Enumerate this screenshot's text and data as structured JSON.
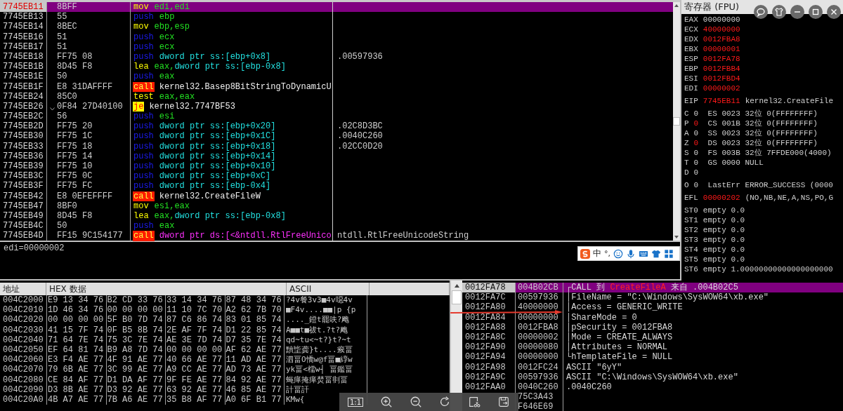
{
  "disassembly": {
    "rows": [
      {
        "address": "7745EB11",
        "bytes": "8BFF",
        "mnemonic": "mov",
        "kind": "move",
        "operands": [
          {
            "text": "edi,edi",
            "kind": "reg"
          }
        ],
        "selected": true,
        "jump_arrow": false
      },
      {
        "address": "7745EB13",
        "bytes": "55",
        "mnemonic": "push",
        "kind": "stack",
        "operands": [
          {
            "text": "ebp",
            "kind": "reg"
          }
        ],
        "selected": false,
        "jump_arrow": false
      },
      {
        "address": "7745EB14",
        "bytes": "8BEC",
        "mnemonic": "mov",
        "kind": "move",
        "operands": [
          {
            "text": "ebp,esp",
            "kind": "reg"
          }
        ],
        "selected": false,
        "jump_arrow": false
      },
      {
        "address": "7745EB16",
        "bytes": "51",
        "mnemonic": "push",
        "kind": "stack",
        "operands": [
          {
            "text": "ecx",
            "kind": "reg"
          }
        ],
        "selected": false,
        "jump_arrow": false
      },
      {
        "address": "7745EB17",
        "bytes": "51",
        "mnemonic": "push",
        "kind": "stack",
        "operands": [
          {
            "text": "ecx",
            "kind": "reg"
          }
        ],
        "selected": false,
        "jump_arrow": false
      },
      {
        "address": "7745EB18",
        "bytes": "FF75 08",
        "mnemonic": "push",
        "kind": "stack",
        "operands": [
          {
            "text": "dword ptr ss:[ebp+0x8]",
            "kind": "mem"
          }
        ],
        "comment": ".00597936",
        "selected": false,
        "jump_arrow": false
      },
      {
        "address": "7745EB1B",
        "bytes": "8D45 F8",
        "mnemonic": "lea",
        "kind": "move",
        "operands": [
          {
            "text": "eax,",
            "kind": "reg"
          },
          {
            "text": "dword ptr ss:[ebp-0x8]",
            "kind": "mem"
          }
        ],
        "selected": false,
        "jump_arrow": false
      },
      {
        "address": "7745EB1E",
        "bytes": "50",
        "mnemonic": "push",
        "kind": "stack",
        "operands": [
          {
            "text": "eax",
            "kind": "reg"
          }
        ],
        "selected": false,
        "jump_arrow": false
      },
      {
        "address": "7745EB1F",
        "bytes": "E8 31DAFFFF",
        "mnemonic": "call",
        "kind": "call",
        "operands": [
          {
            "text": "kernel32.Basep8BitStringToDynamicU",
            "kind": "target"
          }
        ],
        "selected": false,
        "jump_arrow": false
      },
      {
        "address": "7745EB24",
        "bytes": "85C0",
        "mnemonic": "test",
        "kind": "move",
        "operands": [
          {
            "text": "eax,eax",
            "kind": "reg"
          }
        ],
        "selected": false,
        "jump_arrow": false
      },
      {
        "address": "7745EB26",
        "bytes": "0F84 27D40100",
        "mnemonic": "je",
        "kind": "jump",
        "operands": [
          {
            "text": "kernel32.7747BF53",
            "kind": "target"
          }
        ],
        "selected": false,
        "jump_arrow": true
      },
      {
        "address": "7745EB2C",
        "bytes": "56",
        "mnemonic": "push",
        "kind": "stack",
        "operands": [
          {
            "text": "esi",
            "kind": "reg"
          }
        ],
        "selected": false,
        "jump_arrow": false
      },
      {
        "address": "7745EB2D",
        "bytes": "FF75 20",
        "mnemonic": "push",
        "kind": "stack",
        "operands": [
          {
            "text": "dword ptr ss:[ebp+0x20]",
            "kind": "mem"
          }
        ],
        "comment": ".02C8D3BC",
        "selected": false,
        "jump_arrow": false
      },
      {
        "address": "7745EB30",
        "bytes": "FF75 1C",
        "mnemonic": "push",
        "kind": "stack",
        "operands": [
          {
            "text": "dword ptr ss:[ebp+0x1C]",
            "kind": "mem"
          }
        ],
        "comment": ".0040C260",
        "selected": false,
        "jump_arrow": false
      },
      {
        "address": "7745EB33",
        "bytes": "FF75 18",
        "mnemonic": "push",
        "kind": "stack",
        "operands": [
          {
            "text": "dword ptr ss:[ebp+0x18]",
            "kind": "mem"
          }
        ],
        "comment": ".02CC0D20",
        "selected": false,
        "jump_arrow": false
      },
      {
        "address": "7745EB36",
        "bytes": "FF75 14",
        "mnemonic": "push",
        "kind": "stack",
        "operands": [
          {
            "text": "dword ptr ss:[ebp+0x14]",
            "kind": "mem"
          }
        ],
        "selected": false,
        "jump_arrow": false
      },
      {
        "address": "7745EB39",
        "bytes": "FF75 10",
        "mnemonic": "push",
        "kind": "stack",
        "operands": [
          {
            "text": "dword ptr ss:[ebp+0x10]",
            "kind": "mem"
          }
        ],
        "selected": false,
        "jump_arrow": false
      },
      {
        "address": "7745EB3C",
        "bytes": "FF75 0C",
        "mnemonic": "push",
        "kind": "stack",
        "operands": [
          {
            "text": "dword ptr ss:[ebp+0xC]",
            "kind": "mem"
          }
        ],
        "selected": false,
        "jump_arrow": false
      },
      {
        "address": "7745EB3F",
        "bytes": "FF75 FC",
        "mnemonic": "push",
        "kind": "stack",
        "operands": [
          {
            "text": "dword ptr ss:[ebp-0x4]",
            "kind": "mem"
          }
        ],
        "selected": false,
        "jump_arrow": false
      },
      {
        "address": "7745EB42",
        "bytes": "E8 0EFEFFFF",
        "mnemonic": "call",
        "kind": "call",
        "operands": [
          {
            "text": "kernel32.CreateFileW",
            "kind": "target"
          }
        ],
        "selected": false,
        "jump_arrow": false
      },
      {
        "address": "7745EB47",
        "bytes": "8BF0",
        "mnemonic": "mov",
        "kind": "move",
        "operands": [
          {
            "text": "esi,eax",
            "kind": "reg"
          }
        ],
        "selected": false,
        "jump_arrow": false
      },
      {
        "address": "7745EB49",
        "bytes": "8D45 F8",
        "mnemonic": "lea",
        "kind": "move",
        "operands": [
          {
            "text": "eax,",
            "kind": "reg"
          },
          {
            "text": "dword ptr ss:[ebp-0x8]",
            "kind": "mem"
          }
        ],
        "selected": false,
        "jump_arrow": false
      },
      {
        "address": "7745EB4C",
        "bytes": "50",
        "mnemonic": "push",
        "kind": "stack",
        "operands": [
          {
            "text": "eax",
            "kind": "reg"
          }
        ],
        "selected": false,
        "jump_arrow": false
      },
      {
        "address": "7745EB4D",
        "bytes": "FF15 9C154177",
        "mnemonic": "call",
        "kind": "call",
        "operands": [
          {
            "text": "dword ptr ds:[<&ntdll.RtlFreeUnico",
            "kind": "import"
          }
        ],
        "comment": "ntdll.RtlFreeUnicodeString",
        "selected": false,
        "jump_arrow": false
      }
    ]
  },
  "info": {
    "text": "edi=00000002"
  },
  "registers": {
    "title": "寄存器 (FPU)",
    "general": [
      {
        "name": "EAX",
        "value": "00000000",
        "changed": false
      },
      {
        "name": "ECX",
        "value": "40000000",
        "changed": true
      },
      {
        "name": "EDX",
        "value": "0012FBA8",
        "changed": true
      },
      {
        "name": "EBX",
        "value": "00000001",
        "changed": true
      },
      {
        "name": "ESP",
        "value": "0012FA78",
        "changed": true
      },
      {
        "name": "EBP",
        "value": "0012FBB4",
        "changed": true
      },
      {
        "name": "ESI",
        "value": "0012FBD4",
        "changed": true
      },
      {
        "name": "EDI",
        "value": "00000002",
        "changed": true
      }
    ],
    "eip": {
      "name": "EIP",
      "value": "7745EB11",
      "changed": true,
      "comment": "kernel32.CreateFile"
    },
    "flags": [
      {
        "flag": "C",
        "value": "0",
        "changed": false,
        "detail": "ES 0023 32位 0(FFFFFFFF)"
      },
      {
        "flag": "P",
        "value": "0",
        "changed": true,
        "detail": "CS 001B 32位 0(FFFFFFFF)"
      },
      {
        "flag": "A",
        "value": "0",
        "changed": false,
        "detail": "SS 0023 32位 0(FFFFFFFF)"
      },
      {
        "flag": "Z",
        "value": "0",
        "changed": true,
        "detail": "DS 0023 32位 0(FFFFFFFF)"
      },
      {
        "flag": "S",
        "value": "0",
        "changed": false,
        "detail": "FS 003B 32位 7FFDE000(4000)"
      },
      {
        "flag": "T",
        "value": "0",
        "changed": false,
        "detail": "GS 0000 NULL"
      },
      {
        "flag": "D",
        "value": "0",
        "changed": false
      },
      {
        "flag": "O",
        "value": "0",
        "changed": false,
        "detail": "LastErr ERROR_SUCCESS (0000"
      }
    ],
    "efl": {
      "name": "EFL",
      "value": "00000202",
      "changed": true,
      "comment": "(NO,NB,NE,A,NS,PO,G"
    },
    "fpu": [
      {
        "name": "ST0",
        "text": "empty 0.0"
      },
      {
        "name": "ST1",
        "text": "empty 0.0"
      },
      {
        "name": "ST2",
        "text": "empty 0.0"
      },
      {
        "name": "ST3",
        "text": "empty 0.0"
      },
      {
        "name": "ST4",
        "text": "empty 0.0"
      },
      {
        "name": "ST5",
        "text": "empty 0.0"
      },
      {
        "name": "ST6",
        "text": "empty 1.00000000000000000000"
      }
    ]
  },
  "dump": {
    "columns": [
      "地址",
      "HEX 数据",
      "ASCII"
    ],
    "rows": [
      {
        "address": "004C2000",
        "hex": [
          "E9 13 34 76",
          "B2 CD 33 76",
          "33 14 34 76",
          "87 48 34 76"
        ],
        "ascii": "?4v餐3v3■4v噁4v"
      },
      {
        "address": "004C2010",
        "hex": [
          "1D 46 34 76",
          "00 00 00 00",
          "11 10 7C 70",
          "A2 62 7B 70"
        ],
        "ascii": "■F4v....■■|p  {p"
      },
      {
        "address": "004C2020",
        "hex": [
          "00 00 00 00",
          "5F B0 7D 74",
          "87 C6 86 74",
          "83 01 85 74"
        ],
        "ascii": "...._鐙t罷呋?飑"
      },
      {
        "address": "004C2030",
        "hex": [
          "41 15 7F 74",
          "0F B5 8B 74",
          "2E AF 7F 74",
          "D1 22 85 74"
        ],
        "ascii": "A■■t■祓t.?t?飑"
      },
      {
        "address": "004C2040",
        "hex": [
          "71 64 7E 74",
          "75 3C 7E 74",
          "AE 3E 7D 74",
          "D7 35 7E 74"
        ],
        "ascii": "qd~tu<~t?}t?~t"
      },
      {
        "address": "004C2050",
        "hex": [
          "EF 64 81 74",
          "B9 A8 7D 74",
          "00 00 00 00",
          "AF 62 AE 77"
        ],
        "ascii": "黷坒龚}t....瘊畐"
      },
      {
        "address": "004C2060",
        "hex": [
          "E3 F4 AE 77",
          "4F 91 AE 77",
          "40 66 AE 77",
          "11 AD AE 77"
        ],
        "ascii": "泗畐O憍w@f畐■綧w"
      },
      {
        "address": "004C2070",
        "hex": [
          "79 6B AE 77",
          "3C 99 AE 77",
          "A9 CC AE 77",
          "AD 73 AE 77"
        ],
        "ascii": "yk畐<檽w┤ 畐鑑畐"
      },
      {
        "address": "004C2080",
        "hex": [
          "CE 84 AF 77",
          "D1 DA AF 77",
          "9F FE AE 77",
          "84 92 AE 77"
        ],
        "ascii": "蝇瘅掩瘅焚畐剕畐"
      },
      {
        "address": "004C2090",
        "hex": [
          "D3 8B AE 77",
          "D3 92 AE 77",
          "63 92 AE 77",
          "46 85 AE 77"
        ],
        "ascii": "計畐訐"
      },
      {
        "address": "004C20A0",
        "hex": [
          "4B A7 AE 77",
          "7B A6 AE 77",
          "35 B8 AF 77",
          "A0 6F B1 77"
        ],
        "ascii": "KMw{"
      }
    ]
  },
  "stack": {
    "rows": [
      {
        "address": "0012FA78",
        "value": "004B02CB",
        "comment": [
          {
            "text": "┌CALL 到 ",
            "kind": "plain"
          },
          {
            "text": "CreateFileA",
            "kind": "api"
          },
          {
            "text": " 来自 .004B02C5",
            "kind": "plain"
          }
        ],
        "selected": true
      },
      {
        "address": "0012FA7C",
        "value": "00597936",
        "comment": [
          {
            "text": "│FileName = \"C:\\Windows\\SysWOW64\\xb.exe\"",
            "kind": "plain"
          }
        ],
        "selected": false
      },
      {
        "address": "0012FA80",
        "value": "40000000",
        "comment": [
          {
            "text": "│Access = GENERIC_WRITE",
            "kind": "plain"
          }
        ],
        "selected": false
      },
      {
        "address": "0012FA84",
        "value": "00000000",
        "comment": [
          {
            "text": "│ShareMode = 0",
            "kind": "plain"
          }
        ],
        "selected": false
      },
      {
        "address": "0012FA88",
        "value": "0012FBA8",
        "comment": [
          {
            "text": "│pSecurity = 0012FBA8",
            "kind": "plain"
          }
        ],
        "selected": false
      },
      {
        "address": "0012FA8C",
        "value": "00000002",
        "comment": [
          {
            "text": "│Mode = CREATE_ALWAYS",
            "kind": "plain"
          }
        ],
        "selected": false
      },
      {
        "address": "0012FA90",
        "value": "00000080",
        "comment": [
          {
            "text": "│Attributes = NORMAL",
            "kind": "plain"
          }
        ],
        "selected": false
      },
      {
        "address": "0012FA94",
        "value": "00000000",
        "comment": [
          {
            "text": "└hTemplateFile = NULL",
            "kind": "plain"
          }
        ],
        "selected": false
      },
      {
        "address": "0012FA98",
        "value": "0012FC24",
        "comment": [
          {
            "text": "ASCII \"6yY\"",
            "kind": "plain"
          }
        ],
        "selected": false
      },
      {
        "address": "0012FA9C",
        "value": "00597936",
        "comment": [
          {
            "text": "ASCII \"C:\\Windows\\SysWOW64\\xb.exe\"",
            "kind": "plain"
          }
        ],
        "selected": false
      },
      {
        "address": "0012FAA0",
        "value": "0040C260",
        "comment": [
          {
            "text": ".0040C260",
            "kind": "plain"
          }
        ],
        "selected": false
      },
      {
        "value": "75C3A43",
        "selected": false
      },
      {
        "value": "F646E69",
        "selected": false
      }
    ]
  },
  "ime_bar": {
    "language": "中",
    "punctuation": "°,"
  },
  "viewer_toolbar": {
    "actual_size": "1:1"
  }
}
